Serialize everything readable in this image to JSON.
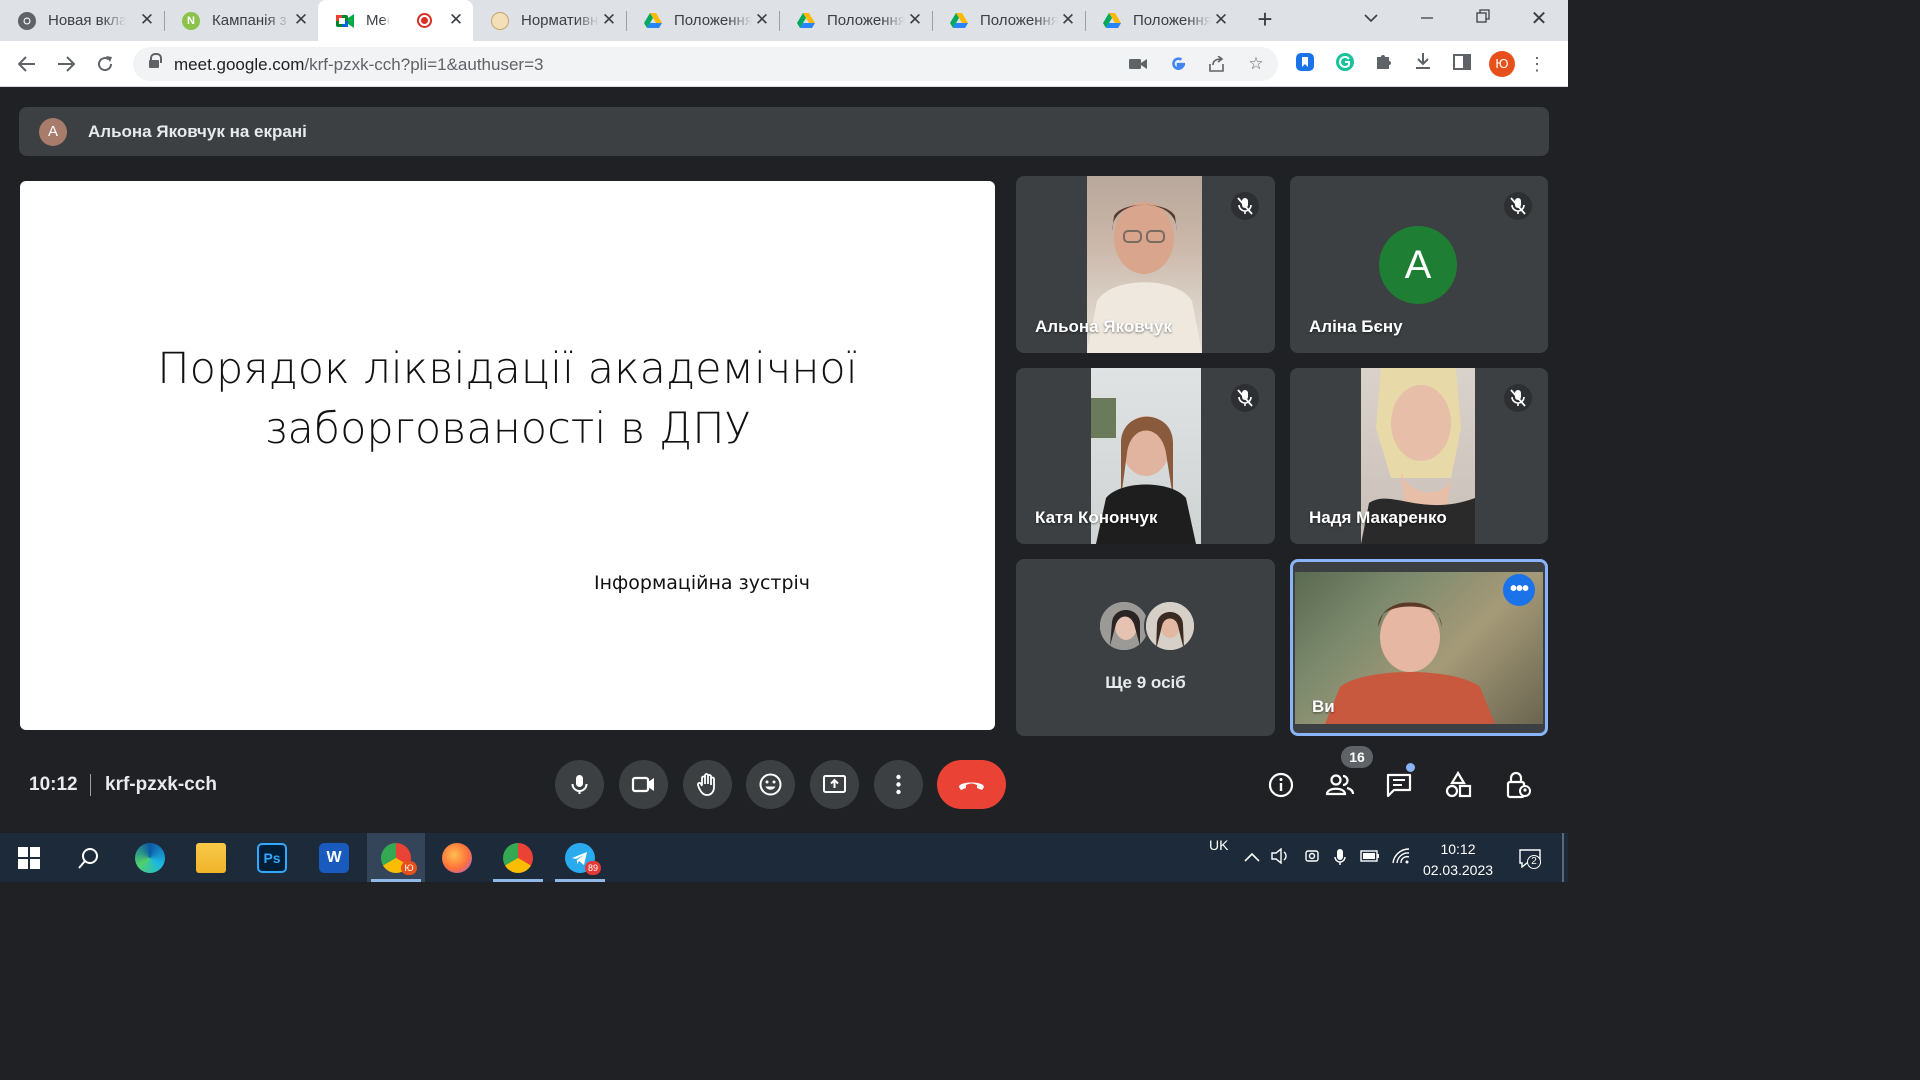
{
  "browser": {
    "tabs": [
      {
        "title": "Новая вкладка",
        "favicon": "chrome-icon",
        "active": false
      },
      {
        "title": "Кампанія з",
        "favicon": "n-icon",
        "active": false
      },
      {
        "title": "Meet: ",
        "favicon": "google-meet-icon",
        "active": true,
        "recording": true
      },
      {
        "title": "Нормативна",
        "favicon": "university-seal-icon",
        "active": false
      },
      {
        "title": "Положення",
        "favicon": "google-drive-icon",
        "active": false
      },
      {
        "title": "Положення",
        "favicon": "google-drive-icon",
        "active": false
      },
      {
        "title": "Положення",
        "favicon": "google-drive-icon",
        "active": false
      },
      {
        "title": "Положення",
        "favicon": "google-drive-icon",
        "active": false
      }
    ],
    "url_main": "meet.google.com",
    "url_rest": "/krf-pzxk-cch?pli=1&authuser=3",
    "profile_initial": "Ю"
  },
  "meet": {
    "presenter_initial": "А",
    "presenter_banner": "Альона Яковчук на екрані",
    "slide": {
      "line1": "Порядок ліквідації академічної",
      "line2": "заборгованості в ДПУ",
      "subtitle": "Інформаційна зустріч"
    },
    "participants": [
      {
        "name": "Альона Яковчук",
        "muted": true,
        "video": true
      },
      {
        "name": "Аліна Бєну",
        "muted": true,
        "video": false,
        "initial": "A"
      },
      {
        "name": "Катя Конончук",
        "muted": true,
        "video": true
      },
      {
        "name": "Надя Макаренко",
        "muted": true,
        "video": true
      }
    ],
    "others_label": "Ще 9 осіб",
    "self_label": "Ви",
    "time": "10:12",
    "meeting_code": "krf-pzxk-cch",
    "participants_count": "16",
    "colors": {
      "accent": "#1a73e8",
      "hangup": "#ea4335",
      "tile": "#3c4043",
      "bg": "#202124"
    }
  },
  "taskbar": {
    "apps": [
      "start-icon",
      "search-icon",
      "edge-icon",
      "file-explorer-icon",
      "photoshop-icon",
      "word-icon",
      "chrome-icon",
      "firefox-icon",
      "chrome-icon",
      "telegram-icon"
    ],
    "telegram_badge": "89",
    "language": "UK",
    "clock_time": "10:12",
    "clock_date": "02.03.2023",
    "notification_count": "2"
  }
}
